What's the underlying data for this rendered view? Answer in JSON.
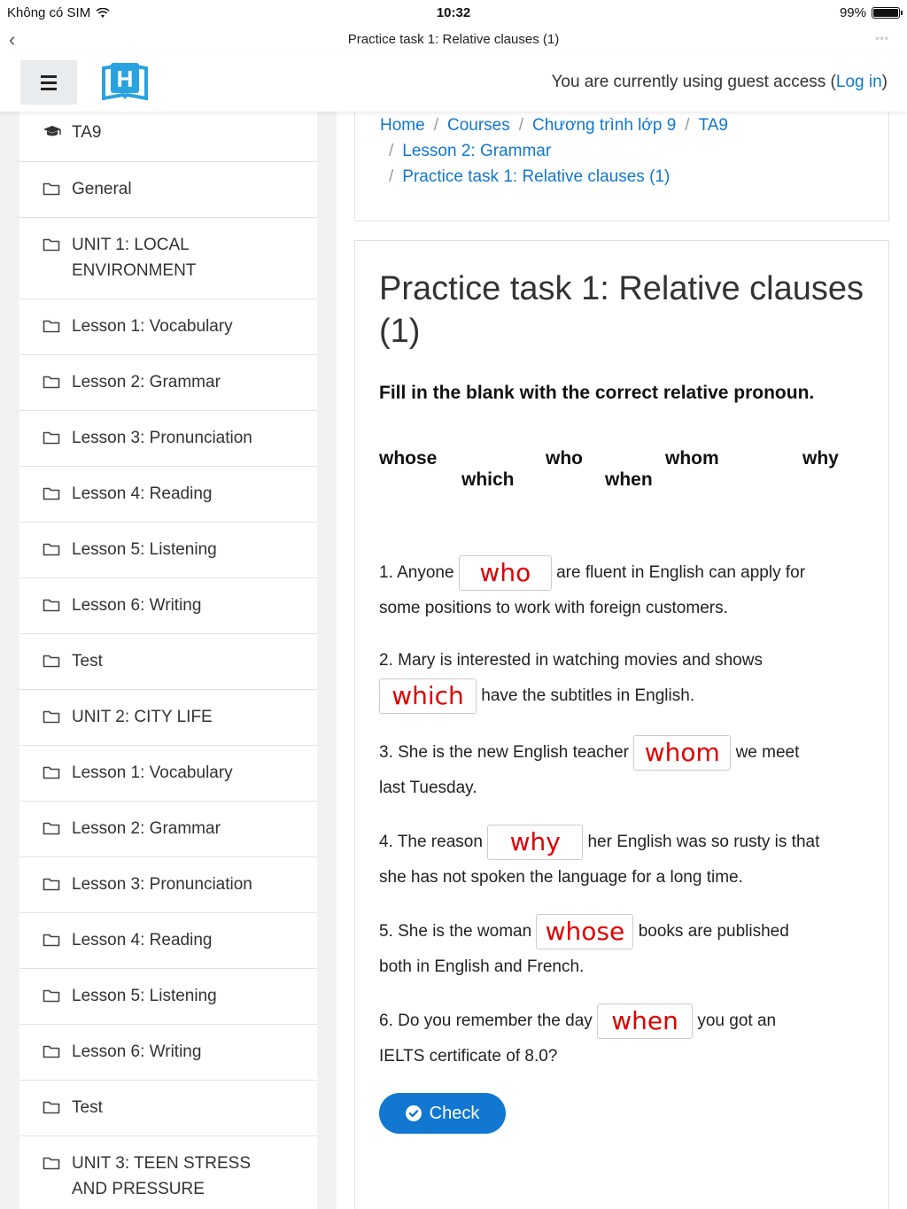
{
  "status_bar": {
    "carrier": "Không có SIM",
    "time": "10:32",
    "battery": "99%",
    "battery_level": 0.99
  },
  "browser": {
    "title": "Practice task 1: Relative clauses (1)"
  },
  "navbar": {
    "guest_prefix": "You are currently using guest access (",
    "login_link": "Log in",
    "guest_suffix": ")",
    "logo_letter": "H"
  },
  "sidebar": {
    "items": [
      {
        "label": "TA9",
        "icon": "graduation-cap-icon"
      },
      {
        "label": "General",
        "icon": "folder-icon"
      },
      {
        "label": "UNIT 1: LOCAL ENVIRONMENT",
        "icon": "folder-icon"
      },
      {
        "label": "Lesson 1: Vocabulary",
        "icon": "folder-icon"
      },
      {
        "label": "Lesson 2: Grammar",
        "icon": "folder-icon"
      },
      {
        "label": "Lesson 3: Pronunciation",
        "icon": "folder-icon"
      },
      {
        "label": "Lesson 4: Reading",
        "icon": "folder-icon"
      },
      {
        "label": "Lesson 5: Listening",
        "icon": "folder-icon"
      },
      {
        "label": "Lesson 6: Writing",
        "icon": "folder-icon"
      },
      {
        "label": "Test",
        "icon": "folder-icon"
      },
      {
        "label": "UNIT 2: CITY LIFE",
        "icon": "folder-icon"
      },
      {
        "label": "Lesson 1: Vocabulary",
        "icon": "folder-icon"
      },
      {
        "label": "Lesson 2: Grammar",
        "icon": "folder-icon"
      },
      {
        "label": "Lesson 3: Pronunciation",
        "icon": "folder-icon"
      },
      {
        "label": "Lesson 4: Reading",
        "icon": "folder-icon"
      },
      {
        "label": "Lesson 5: Listening",
        "icon": "folder-icon"
      },
      {
        "label": "Lesson 6: Writing",
        "icon": "folder-icon"
      },
      {
        "label": "Test",
        "icon": "folder-icon"
      },
      {
        "label": "UNIT 3: TEEN STRESS AND PRESSURE",
        "icon": "folder-icon"
      }
    ]
  },
  "breadcrumb": {
    "home": "Home",
    "courses": "Courses",
    "program": "Chương trình lớp 9",
    "course": "TA9",
    "lesson": "Lesson 2: Grammar",
    "current": "Practice task 1: Relative clauses (1)",
    "separator": "/"
  },
  "quiz": {
    "title": "Practice task 1: Relative clauses (1)",
    "instruction": "Fill in the blank with the correct relative pronoun.",
    "word_bank": [
      "whose",
      "which",
      "who",
      "when",
      "whom",
      "why"
    ],
    "questions": [
      {
        "before": "1. Anyone",
        "answer": "who",
        "after": "are fluent in English can apply for",
        "line2": "some positions to work with foreign customers."
      },
      {
        "before": "2. Mary is interested in watching movies and shows",
        "answer": "which",
        "after": "have the subtitles in English."
      },
      {
        "before": "3. She is the new English teacher",
        "answer": "whom",
        "after": "we meet",
        "line2": "last Tuesday."
      },
      {
        "before": "4. The reason",
        "answer": "why",
        "after": "her English was so rusty is that",
        "line2": "she has not spoken the language for a long time."
      },
      {
        "before": "5. She is the woman",
        "answer": "whose",
        "after": "books are published",
        "line2": "both in English and French."
      },
      {
        "before": "6. Do you remember the day",
        "answer": "when",
        "after": "you got an",
        "line2": "IELTS certificate of 8.0?"
      }
    ],
    "check_label": "Check"
  },
  "colors": {
    "link": "#1177d1",
    "answer": "#e00000",
    "button": "#1177d1"
  }
}
